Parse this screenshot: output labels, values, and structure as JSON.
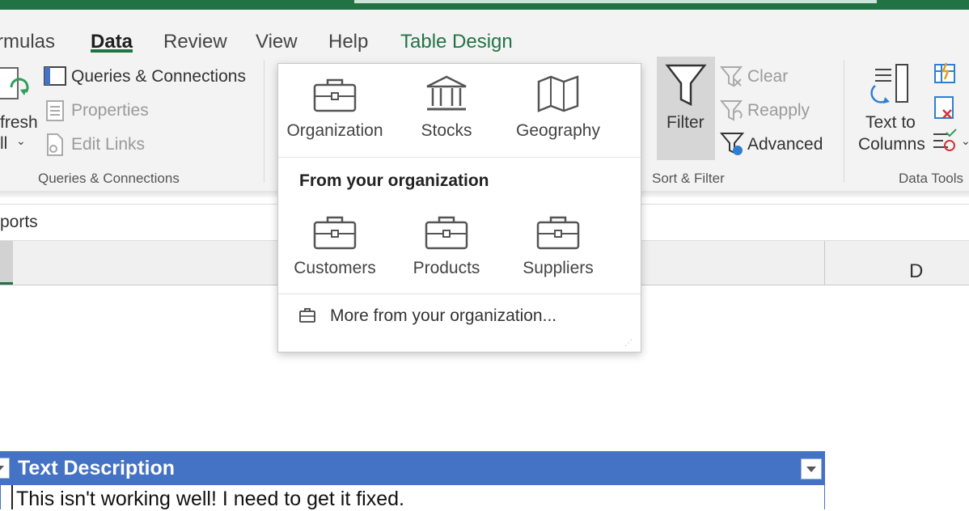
{
  "tabs": [
    {
      "label": "rmulas"
    },
    {
      "label": "Data"
    },
    {
      "label": "Review"
    },
    {
      "label": "View"
    },
    {
      "label": "Help"
    },
    {
      "label": "Table Design"
    }
  ],
  "ribbon": {
    "refresh_partial": "fresh",
    "refresh_all_partial": "ll",
    "queries_connections": "Queries & Connections",
    "properties": "Properties",
    "edit_links": "Edit Links",
    "group_queries": "Queries & Connections",
    "filter": "Filter",
    "clear": "Clear",
    "reapply": "Reapply",
    "advanced": "Advanced",
    "group_sort_filter": "Sort & Filter",
    "text_to": "Text to",
    "columns": "Columns",
    "group_data_tools": "Data Tools"
  },
  "namebox_partial": "ports",
  "column_d": "D",
  "popup": {
    "types": [
      {
        "label": "Organization",
        "icon": "briefcase-icon"
      },
      {
        "label": "Stocks",
        "icon": "bank-icon"
      },
      {
        "label": "Geography",
        "icon": "map-icon"
      }
    ],
    "heading": "From your organization",
    "org_items": [
      {
        "label": "Customers",
        "icon": "briefcase-icon"
      },
      {
        "label": "Products",
        "icon": "briefcase-icon"
      },
      {
        "label": "Suppliers",
        "icon": "briefcase-icon"
      }
    ],
    "more": "More from your organization..."
  },
  "table": {
    "header": "Text Description",
    "row1": "This isn't working well! I need to get it fixed."
  },
  "colors": {
    "excel_green": "#217346",
    "table_header_blue": "#4472c4",
    "ribbon_bg": "#f3f3f3"
  }
}
